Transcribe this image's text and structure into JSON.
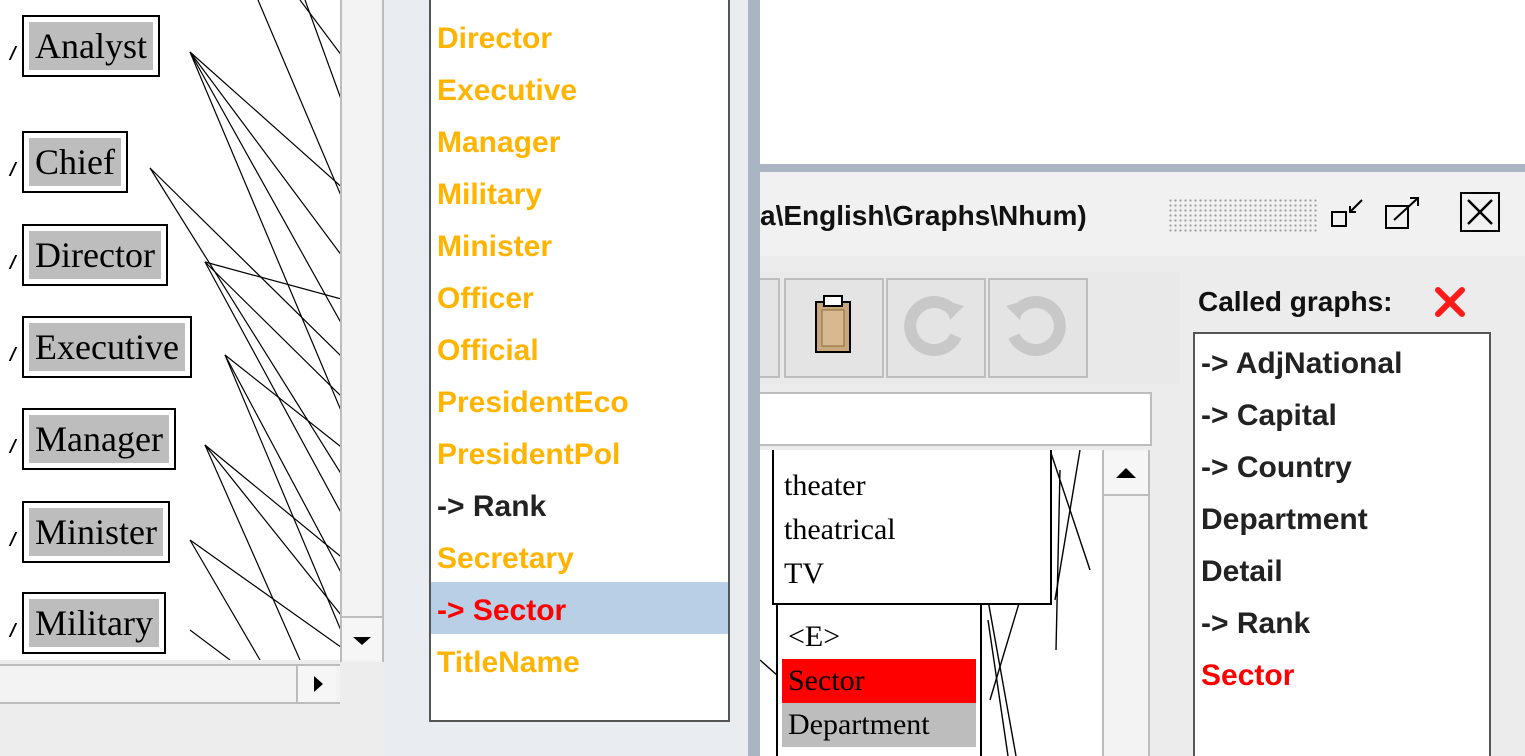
{
  "graph_nodes": [
    "Analyst",
    "Chief",
    "Director",
    "Executive",
    "Manager",
    "Minister",
    "Military"
  ],
  "graph_list": {
    "items": [
      {
        "label": "Director",
        "color": "#ffb400"
      },
      {
        "label": "Executive",
        "color": "#ffb400"
      },
      {
        "label": "Manager",
        "color": "#ffb400"
      },
      {
        "label": "Military",
        "color": "#ffb400"
      },
      {
        "label": "Minister",
        "color": "#ffb400"
      },
      {
        "label": "Officer",
        "color": "#ffb400"
      },
      {
        "label": "Official",
        "color": "#ffb400"
      },
      {
        "label": "PresidentEco",
        "color": "#ffb400"
      },
      {
        "label": "PresidentPol",
        "color": "#ffb400"
      },
      {
        "label": "-> Rank",
        "color": "#222222"
      },
      {
        "label": "Secretary",
        "color": "#ffb400"
      },
      {
        "label": "-> Sector",
        "color": "#ff0000",
        "selected": true
      },
      {
        "label": "TitleName",
        "color": "#ffb400"
      }
    ]
  },
  "window": {
    "title": "a\\English\\Graphs\\Nhum)",
    "called_graphs_label": "Called graphs:",
    "called_graphs": [
      {
        "label": "-> AdjNational",
        "color": "#222222"
      },
      {
        "label": "-> Capital",
        "color": "#222222"
      },
      {
        "label": "-> Country",
        "color": "#222222"
      },
      {
        "label": "Department",
        "color": "#222222"
      },
      {
        "label": "Detail",
        "color": "#222222"
      },
      {
        "label": "-> Rank",
        "color": "#222222"
      },
      {
        "label": "Sector",
        "color": "#ff0000"
      }
    ]
  },
  "box_upper": [
    "theater",
    "theatrical",
    "TV"
  ],
  "box_lower": [
    {
      "label": "<E>",
      "highlight": "none"
    },
    {
      "label": "Sector",
      "highlight": "red"
    },
    {
      "label": "Department",
      "highlight": "gray"
    }
  ],
  "icons": [
    "minimize-icon",
    "maximize-icon",
    "close-icon",
    "paste-icon",
    "redo-icon",
    "undo-icon",
    "scroll-up-arrow-icon",
    "scroll-down-arrow-icon",
    "scroll-right-arrow-icon",
    "red-x-icon"
  ]
}
